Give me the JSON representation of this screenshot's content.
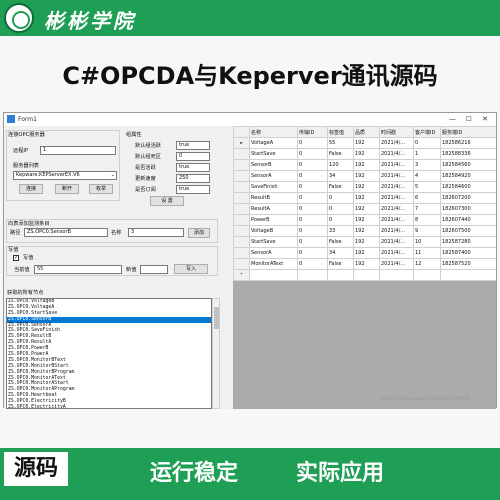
{
  "banner": {
    "academy": "彬彬学院",
    "headline": "C#OPCDA与Keperver通讯源码",
    "bottom_left": "源码",
    "bottom_tag1": "运行稳定",
    "bottom_tag2": "实际应用",
    "watermark": "https://blog.csdn.net/u01478030",
    "brand_color": "#1f9e55"
  },
  "window": {
    "title": "Form1",
    "controls": {
      "minimize": "—",
      "maximize": "☐",
      "close": "✕"
    }
  },
  "connect": {
    "group": "连接OPC服务器",
    "ip_label": "远程IP",
    "ip_value": "1",
    "server_list_label": "服务器列表",
    "server_value": "Kepware.KEPServerEX.V6",
    "connect_btn": "连接",
    "disconnect_btn": "断开",
    "browse_btn": "枚举"
  },
  "group_props": {
    "title": "组属性",
    "active_label": "默认组活跃",
    "active_value": "true",
    "deadband_label": "默认组死区",
    "deadband_value": "0",
    "subscribe_label": "是否活跃",
    "subscribe_value": "true",
    "rate_label": "更新速度",
    "rate_value": "250",
    "sub_label": "是否订阅",
    "sub_value": "true",
    "set_btn": "设 置"
  },
  "add_item": {
    "group": "向表添加监测条目",
    "path_label": "路径",
    "path_value": "ZS.OPC0.SensorB",
    "name_label": "名称",
    "name_value": "3",
    "add_btn": "添加"
  },
  "write": {
    "group": "写值",
    "checkbox_label": "写值",
    "current_label": "当前值",
    "current_value": "55",
    "new_label": "新值",
    "write_btn": "写入"
  },
  "node_list": {
    "label": "获取的所有节点",
    "items": [
      "ZS.OPC0.VoltageB",
      "ZS.OPC0.VoltageA",
      "ZS.OPC0.StartSave",
      "ZS.OPC0.SensorB",
      "ZS.OPC0.SensorA",
      "ZS.OPC0.SaveFinish",
      "ZS.OPC0.ResultB",
      "ZS.OPC0.ResultA",
      "ZS.OPC0.PowerB",
      "ZS.OPC0.PowerA",
      "ZS.OPC0.MonitorBText",
      "ZS.OPC0.MonitorBStart",
      "ZS.OPC0.MonitorBProgram",
      "ZS.OPC0.MonitorAText",
      "ZS.OPC0.MonitorAStart",
      "ZS.OPC0.MonitorAProgram",
      "ZS.OPC0.Heartbeat",
      "ZS.OPC0.ElectricityB",
      "ZS.OPC0.ElectricityA",
      "ZS.OPC0._InternalTags._Slot"
    ],
    "selected_index": 3
  },
  "grid": {
    "columns": [
      "名称",
      "传输ID",
      "标签值",
      "品质",
      "时间戳",
      "客户端ID",
      "服务端ID"
    ],
    "rows": [
      [
        "VoltageA",
        "0",
        "55",
        "192",
        "2021/4/...",
        "0",
        "182586216"
      ],
      [
        "StartSave",
        "0",
        "False",
        "192",
        "2021/4/...",
        "1",
        "182588336"
      ],
      [
        "SensorB",
        "0",
        "120",
        "192",
        "2021/4/...",
        "3",
        "182584560"
      ],
      [
        "SensorA",
        "0",
        "34",
        "192",
        "2021/4/...",
        "4",
        "182584920"
      ],
      [
        "SaveFinish",
        "0",
        "False",
        "192",
        "2021/4/...",
        "5",
        "182584600"
      ],
      [
        "ResultB",
        "0",
        "0",
        "192",
        "2021/4/...",
        "6",
        "182607200"
      ],
      [
        "ResultA",
        "0",
        "0",
        "192",
        "2021/4/...",
        "7",
        "182607300"
      ],
      [
        "PowerB",
        "0",
        "0",
        "192",
        "2021/4/...",
        "8",
        "182607440"
      ],
      [
        "VoltageB",
        "0",
        "33",
        "192",
        "2021/4/...",
        "9",
        "182607500"
      ],
      [
        "StartSave",
        "0",
        "False",
        "192",
        "2021/4/...",
        "10",
        "182587280"
      ],
      [
        "SensorA",
        "0",
        "34",
        "192",
        "2021/4/...",
        "11",
        "182587400"
      ],
      [
        "MonitorAText",
        "0",
        "False",
        "192",
        "2021/4/...",
        "12",
        "182587520"
      ]
    ],
    "current_marker": "▸",
    "new_row_marker": "*"
  }
}
